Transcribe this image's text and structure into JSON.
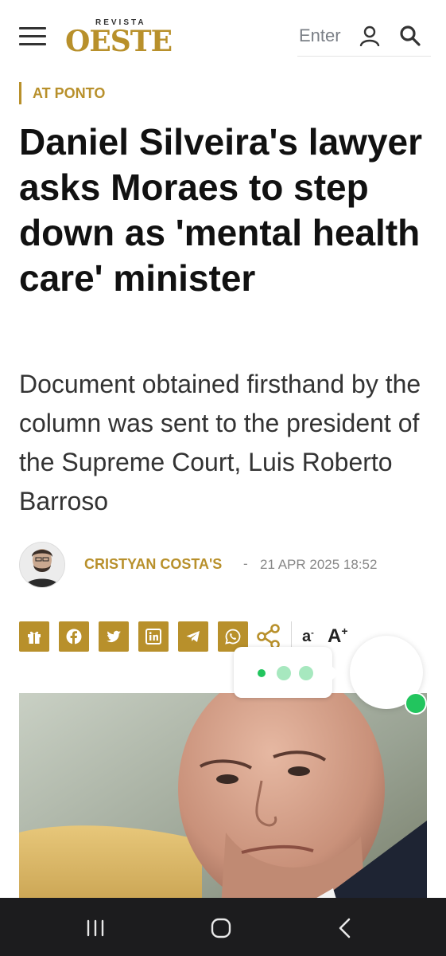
{
  "header": {
    "logo_small": "REVISTA",
    "logo_main": "OESTE",
    "enter_label": "Enter",
    "icons": [
      "hamburger-menu-icon",
      "user-icon",
      "search-icon"
    ]
  },
  "article": {
    "section": "AT PONTO",
    "title": "Daniel Silveira's lawyer asks Moraes to step down as 'mental health care' minister",
    "subtitle": "Document obtained firsthand by the column was sent to the president of the Supreme Court, Luis Roberto Barroso",
    "author": "CRISTYAN COSTA'S",
    "separator": "-",
    "date": "21 APR 2025 18:52"
  },
  "share_bar": {
    "buttons": [
      "gift-icon",
      "facebook-icon",
      "twitter-icon",
      "linkedin-icon",
      "telegram-icon",
      "whatsapp-icon",
      "share-icon"
    ],
    "font_small": "a",
    "font_large": "A"
  },
  "colors": {
    "brand": "#b8902b",
    "text": "#111111",
    "muted": "#888888",
    "nav_bar": "#1c1c1e",
    "online": "#22c55e"
  }
}
